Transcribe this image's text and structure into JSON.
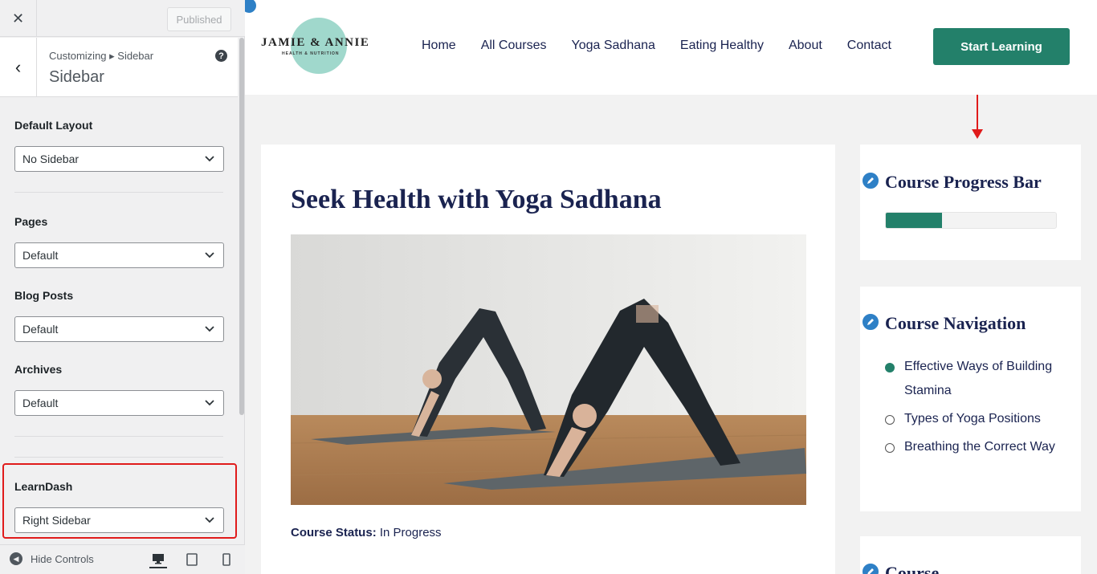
{
  "customizer": {
    "published_label": "Published",
    "breadcrumb": "Customizing ▸ Sidebar",
    "title": "Sidebar",
    "controls": [
      {
        "label": "Default Layout",
        "value": "No Sidebar"
      },
      {
        "label": "Pages",
        "value": "Default"
      },
      {
        "label": "Blog Posts",
        "value": "Default"
      },
      {
        "label": "Archives",
        "value": "Default"
      },
      {
        "label": "LearnDash",
        "value": "Right Sidebar"
      }
    ],
    "hide_controls_label": "Hide Controls"
  },
  "site": {
    "logo_name": "JAMIE & ANNIE",
    "logo_sub": "HEALTH & NUTRITION",
    "nav": [
      "Home",
      "All Courses",
      "Yoga Sadhana",
      "Eating Healthy",
      "About",
      "Contact"
    ],
    "cta_label": "Start Learning",
    "post_title": "Seek Health with Yoga Sadhana",
    "status_label": "Course Status:",
    "status_value": "In Progress",
    "widgets": {
      "progress_title": "Course Progress Bar",
      "progress_value": 0.33,
      "navigation_title": "Course Navigation",
      "lessons": [
        {
          "text": "Effective Ways of Building Stamina",
          "done": true
        },
        {
          "text": "Types of Yoga Positions",
          "done": false
        },
        {
          "text": "Breathing the Correct Way",
          "done": false
        }
      ],
      "third_title": "Course"
    }
  },
  "colors": {
    "accent": "#23806a",
    "navy": "#1a2350",
    "edit_blue": "#2e80c6",
    "highlight_red": "#e01b1b"
  }
}
